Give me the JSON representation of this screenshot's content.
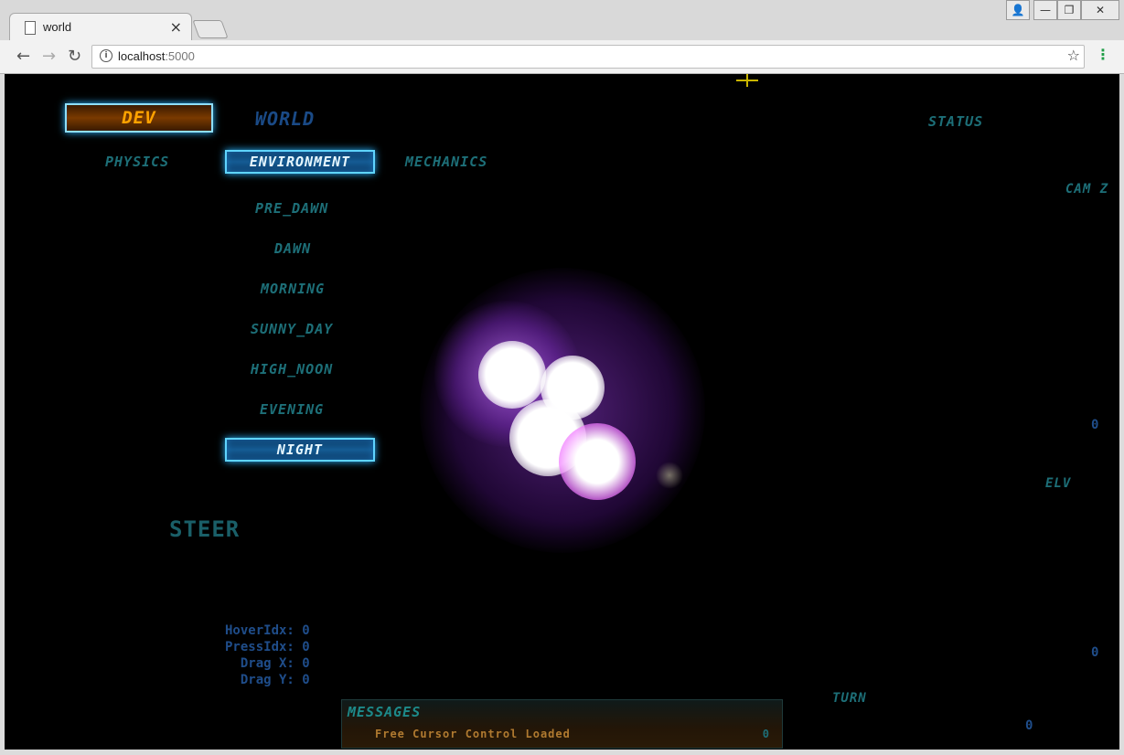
{
  "browser": {
    "tab_title": "world",
    "tab_close": "×",
    "url_host": "localhost",
    "url_port": ":5000",
    "window_controls": [
      "👤",
      "—",
      "❐",
      "✕"
    ]
  },
  "game": {
    "top_tabs": {
      "dev": "DEV",
      "world": "WORLD"
    },
    "status": "STATUS",
    "sub_tabs": [
      "PHYSICS",
      "ENVIRONMENT",
      "MECHANICS"
    ],
    "environment_options": [
      "PRE_DAWN",
      "DAWN",
      "MORNING",
      "SUNNY_DAY",
      "HIGH_NOON",
      "EVENING",
      "NIGHT"
    ],
    "selected_environment": "NIGHT",
    "steer": "STEER",
    "cam_z": "CAM Z",
    "elv": "ELV",
    "turn": "TURN",
    "readouts": {
      "cam_z": "0",
      "elv": "0",
      "turn": "0",
      "bottom": "0"
    },
    "debug": {
      "hover_idx": "HoverIdx: 0",
      "press_idx": "PressIdx: 0",
      "drag_x": "  Drag X: 0",
      "drag_y": "  Drag Y: 0"
    },
    "messages": {
      "title": "MESSAGES",
      "text": "Free Cursor Control Loaded",
      "count": "0"
    }
  },
  "colors": {
    "teal": "#1d6f78",
    "glow": "#5fd4ff",
    "dev_orange": "#ffa300",
    "orb": "#b24dff"
  }
}
